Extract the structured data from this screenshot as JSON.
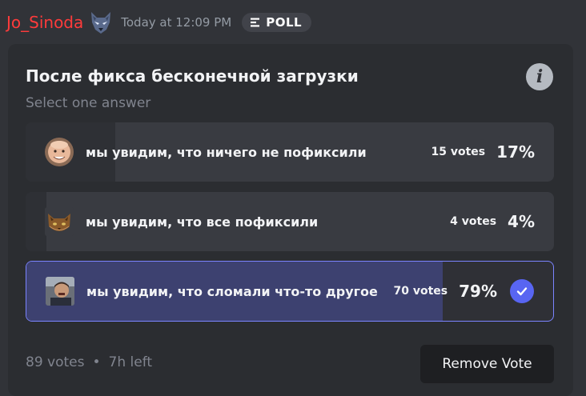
{
  "message": {
    "username": "Jo_Sinoda",
    "timestamp": "Today at 12:09 PM",
    "badge": "POLL"
  },
  "poll": {
    "question": "После фикса бесконечной загрузки",
    "hint": "Select one answer",
    "answers": [
      {
        "text": "мы увидим, что ничего не пофиксили",
        "votes": "15 votes",
        "percent": "17%",
        "fraction": 0.17,
        "selected": false,
        "avatar_icon": "bald-man-face-icon"
      },
      {
        "text": "мы увидим, что все пофиксили",
        "votes": "4 votes",
        "percent": "4%",
        "fraction": 0.04,
        "selected": false,
        "avatar_icon": "cat-face-icon"
      },
      {
        "text": "мы увидим, что сломали что-то другое",
        "votes": "70 votes",
        "percent": "79%",
        "fraction": 0.79,
        "selected": true,
        "avatar_icon": "man-photo-icon"
      }
    ],
    "total_votes": "89 votes",
    "separator": "•",
    "time_left": "7h left",
    "remove_vote_label": "Remove Vote"
  },
  "colors": {
    "username": "#ff3b3b",
    "accent": "#5865f2",
    "background": "#313338",
    "card": "#2b2d31"
  }
}
